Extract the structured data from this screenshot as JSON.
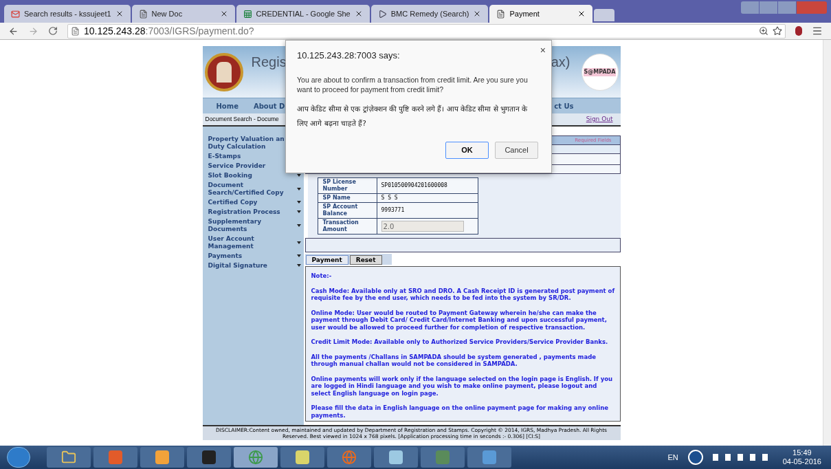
{
  "browser": {
    "tabs": [
      {
        "title": "Search results - kssujeet1",
        "selected": false
      },
      {
        "title": "New Doc",
        "selected": false
      },
      {
        "title": "CREDENTIAL - Google She",
        "selected": false
      },
      {
        "title": "BMC Remedy (Search)",
        "selected": false
      },
      {
        "title": "Payment",
        "selected": true
      }
    ],
    "url_host": "10.125.243.28",
    "url_rest": ":7003/IGRS/payment.do?"
  },
  "header": {
    "title_left": "Regis",
    "title_right": "ax)",
    "logo_text": "S@MPADA"
  },
  "nav": [
    "Home",
    "About D",
    "ct Us"
  ],
  "breadcrumb": {
    "text": "Document Search - Docume",
    "sign_out": "Sign Out"
  },
  "sidebar": [
    {
      "label": "Property Valuation an Duty Calculation",
      "has_menu": false
    },
    {
      "label": "E-Stamps",
      "has_menu": false
    },
    {
      "label": "Service Provider",
      "has_menu": false
    },
    {
      "label": "Slot Booking",
      "has_menu": true
    },
    {
      "label": "Document Search/Certified Copy",
      "has_menu": true
    },
    {
      "label": "Certified Copy",
      "has_menu": true
    },
    {
      "label": "Registration Process",
      "has_menu": true
    },
    {
      "label": "Supplementary Documents",
      "has_menu": true
    },
    {
      "label": "User Account Management",
      "has_menu": true
    },
    {
      "label": "Payments",
      "has_menu": true
    },
    {
      "label": "Digital Signature",
      "has_menu": true
    }
  ],
  "form": {
    "required_note": "Required Fields",
    "rows": [
      {
        "label": "SP License Number",
        "value": "SP010500904201600008",
        "kind": "text"
      },
      {
        "label": "SP Name",
        "value": "S S S",
        "kind": "text"
      },
      {
        "label": "SP Account Balance",
        "value": "9993771",
        "kind": "text"
      },
      {
        "label": "Transaction Amount",
        "value": "2.0",
        "kind": "input"
      }
    ],
    "buttons": [
      {
        "label": "Payment",
        "selected": true
      },
      {
        "label": "Reset",
        "selected": false
      }
    ]
  },
  "notes": [
    "Note:-",
    "Cash Mode: Available only at SRO and DRO. A Cash Receipt ID is generated post payment of requisite fee by the end user, which needs to be fed into the system by SR/DR.",
    "Online Mode: User would be routed to Payment Gateway wherein he/she can make the payment through Debit Card/ Credit Card/Internet Banking and upon successful payment, user would be allowed to proceed further for completion of respective transaction.",
    "Credit Limit Mode: Available only to Authorized Service Providers/Service Provider Banks.",
    "All the payments /Challans in SAMPADA should be system generated , payments made through manual challan would not be considered in SAMPADA.",
    "Online payments will work only if the language selected on the login page is English. If you are logged in Hindi language and you wish to make online payment, please logout and select English language on login page.",
    "Please fill the data in English language on the online payment page for making any online payments."
  ],
  "footer": "DISCLAIMER:Content owned, maintained and updated by Department of Registration and Stamps. Copyright © 2014, IGRS, Madhya Pradesh. All Rights Reserved. Best viewed in 1024 x 768 pixels. [Application processing time in seconds :- 0.306] [CI:S]",
  "dialog": {
    "title": "10.125.243.28:7003 says:",
    "close": "×",
    "message": "You are about to confirm a transaction from credit limit. Are you sure you want to proceed for payment from credit limit?",
    "message_hindi": "आप केडिट सीमा से एक ट्रांज़ेक्शन की पुष्टि करने लगे हैं। आप केडिट सीमा से भुगतान के लिए आगे बढ़ना चाहते हैं?",
    "buttons": [
      {
        "label": "OK",
        "selected": true
      },
      {
        "label": "Cancel",
        "selected": false
      }
    ]
  },
  "taskbar": {
    "language": "EN",
    "time": "15:49",
    "date": "04-05-2016"
  }
}
